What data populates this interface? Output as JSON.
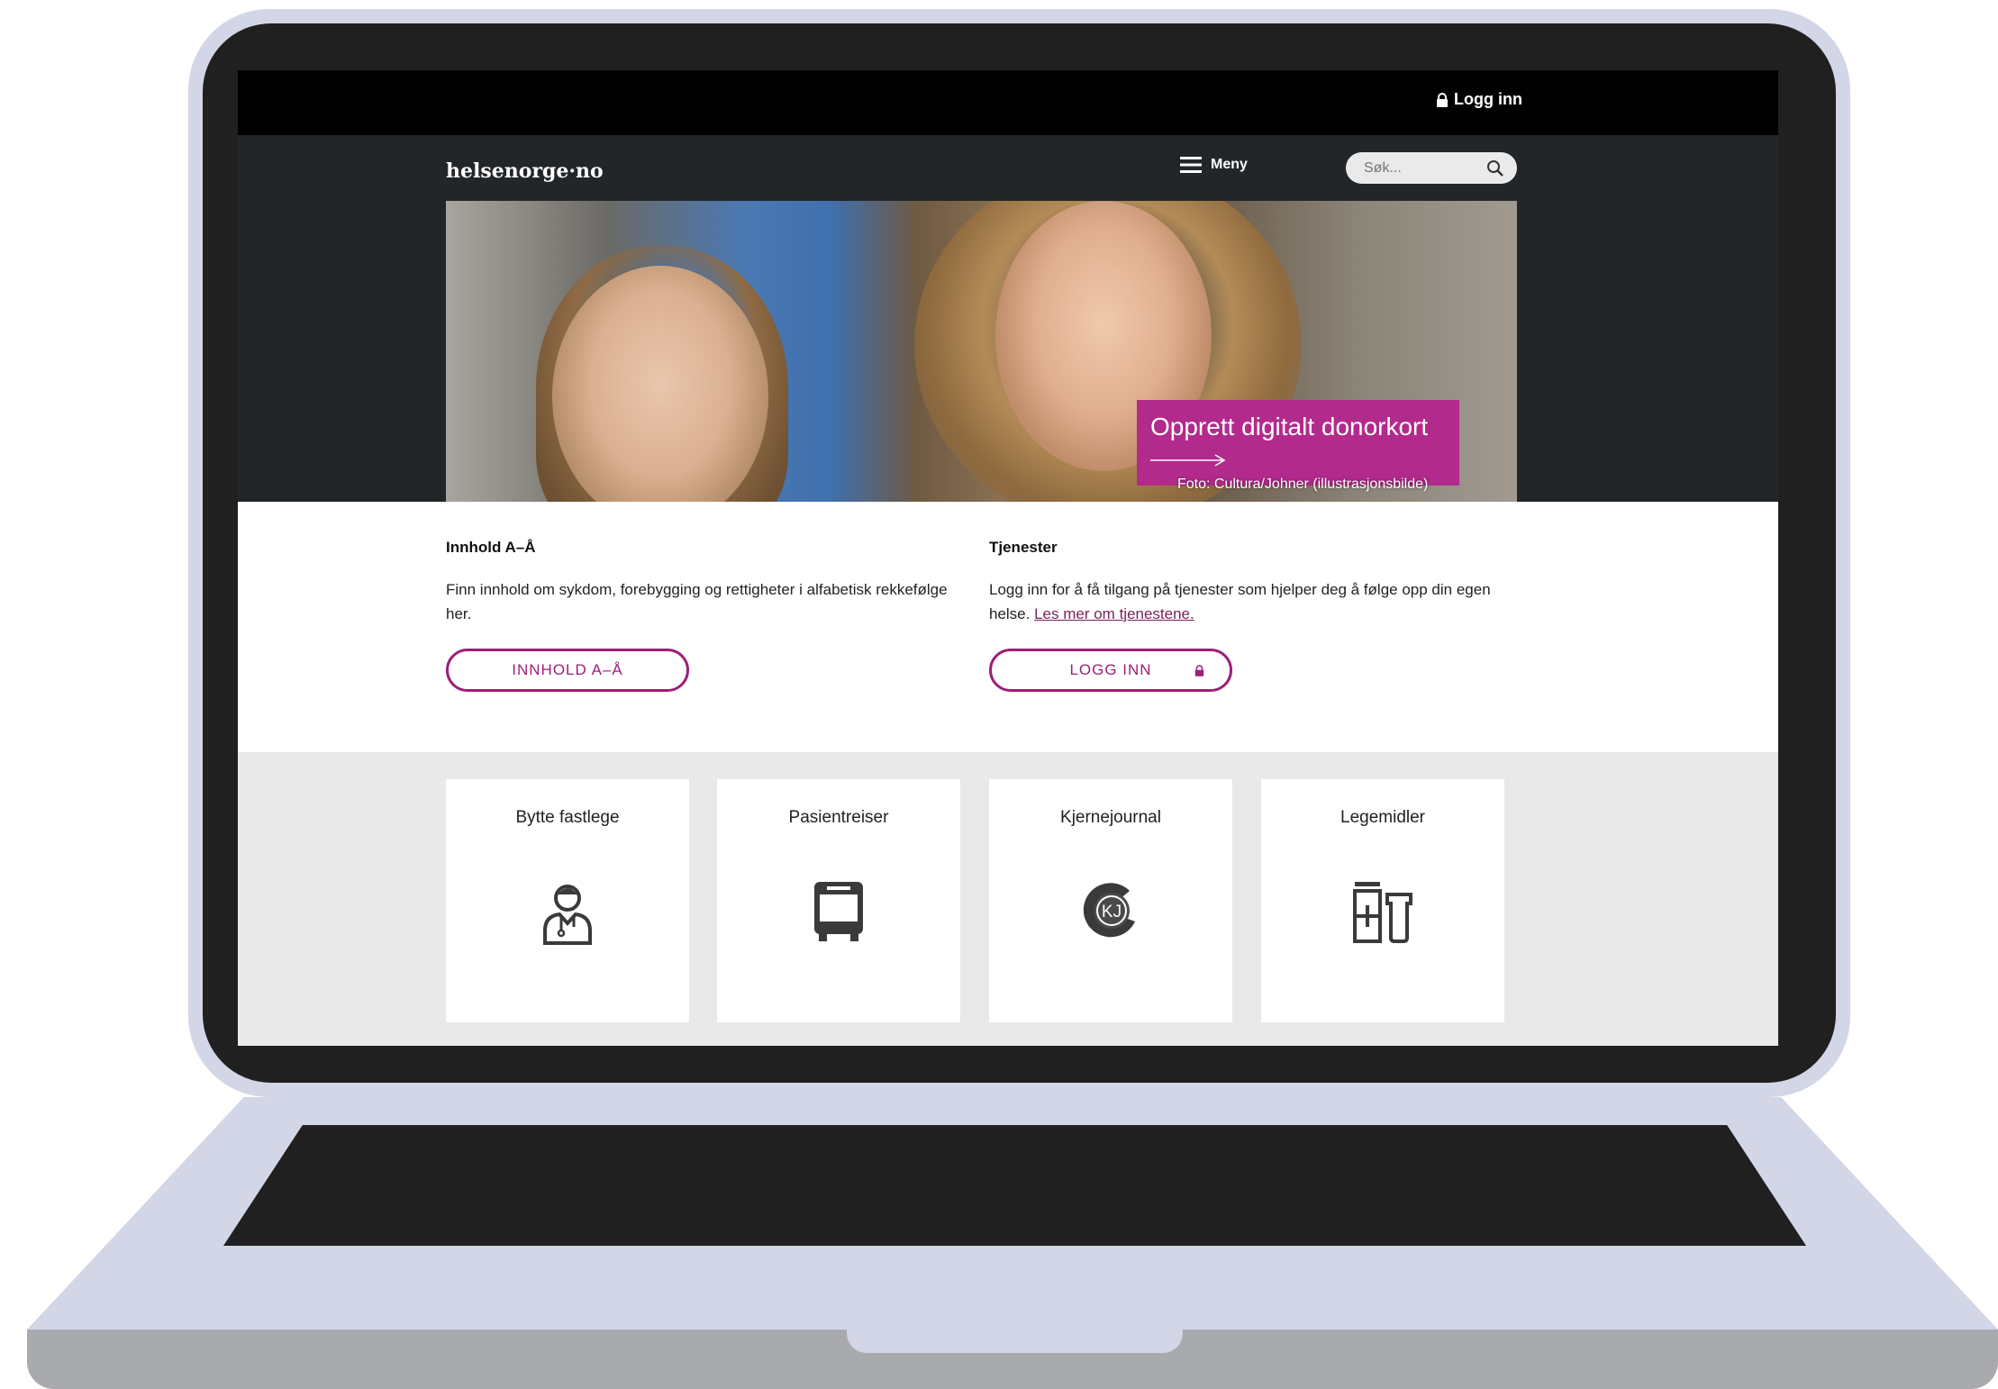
{
  "header": {
    "login_label": "Logg inn",
    "logo": "helsenorge·no",
    "menu_label": "Meny",
    "search_placeholder": "Søk..."
  },
  "hero": {
    "promo_title": "Opprett digitalt donorkort",
    "photo_credit": "Foto: Cultura/Johner (illustrasjonsbilde)"
  },
  "content": {
    "left": {
      "title": "Innhold A–Å",
      "text": "Finn innhold om sykdom, forebygging og rettigheter i alfabetisk rekkefølge her.",
      "button": "INNHOLD A–Å"
    },
    "right": {
      "title": "Tjenester",
      "text": "Logg inn for å få tilgang på tjenester som hjelper deg å følge opp din egen helse. ",
      "link": "Les mer om tjenestene.",
      "button": "LOGG INN"
    }
  },
  "services": [
    {
      "label": "Bytte fastlege",
      "icon": "doctor-icon"
    },
    {
      "label": "Pasientreiser",
      "icon": "bus-icon"
    },
    {
      "label": "Kjernejournal",
      "icon": "kj-logo-icon"
    },
    {
      "label": "Legemidler",
      "icon": "medicine-icon"
    }
  ],
  "colors": {
    "brand": "#9c1f7a",
    "promo": "#b22b8c",
    "dark_header": "#232629"
  }
}
